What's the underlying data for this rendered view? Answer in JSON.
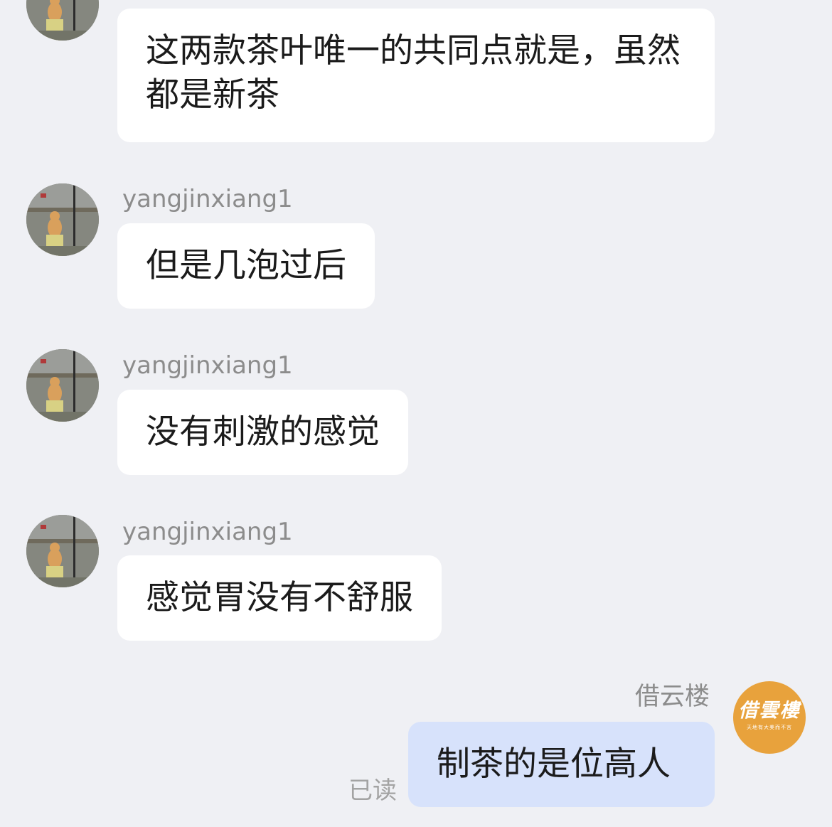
{
  "colors": {
    "background": "#eff0f4",
    "incoming_bubble": "#ffffff",
    "outgoing_bubble": "#d7e2fb",
    "name_text": "#8c8c8c",
    "my_avatar": "#e8a23c"
  },
  "conversation": {
    "messages": [
      {
        "sender": "yangjinxiang1",
        "direction": "incoming",
        "avatar_icon": "cat-photo-avatar",
        "text": "这两款茶叶唯一的共同点就是，虽然都是新茶"
      },
      {
        "sender": "yangjinxiang1",
        "direction": "incoming",
        "avatar_icon": "cat-photo-avatar",
        "text": "但是几泡过后"
      },
      {
        "sender": "yangjinxiang1",
        "direction": "incoming",
        "avatar_icon": "cat-photo-avatar",
        "text": "没有刺激的感觉"
      },
      {
        "sender": "yangjinxiang1",
        "direction": "incoming",
        "avatar_icon": "cat-photo-avatar",
        "text": "感觉胃没有不舒服"
      },
      {
        "sender": "借云楼",
        "direction": "outgoing",
        "avatar_icon": "brand-logo-avatar",
        "text": "制茶的是位高人",
        "status": "已读"
      }
    ]
  },
  "my_avatar": {
    "title": "借雲樓",
    "subtitle": "天地有大美而不言"
  }
}
